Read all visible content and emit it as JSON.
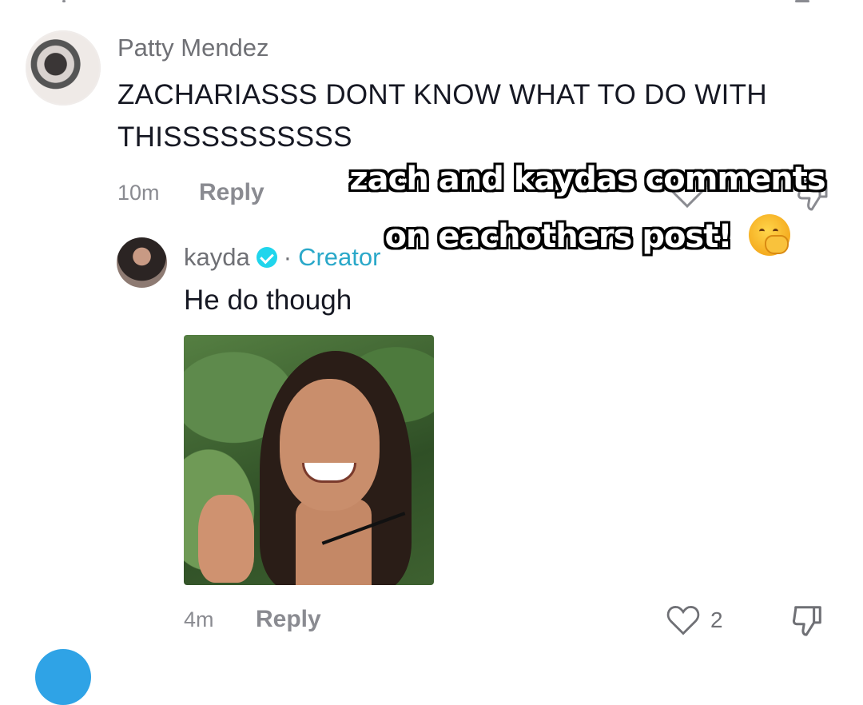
{
  "comments": [
    {
      "author": "Patty Mendez",
      "text": "ZACHARIASSS DONT KNOW WHAT TO DO WITH THISSSSSSSSSS",
      "time": "10m",
      "reply_label": "Reply",
      "avatar": "avatar-photo"
    }
  ],
  "reply": {
    "author": "kayda",
    "badge": "verified-icon",
    "separator": "·",
    "role": "Creator",
    "text": "He do though",
    "attachment": "reaction-image",
    "time": "4m",
    "reply_label": "Reply",
    "likes": "2"
  },
  "overlay": {
    "line1": "zach and kaydas comments",
    "line2": "on eachothers post!",
    "emoji": "face-with-hand-over-mouth"
  },
  "icons": {
    "like": "heart-icon",
    "dislike": "thumbs-down-icon"
  },
  "colors": {
    "creator_accent": "#2aa8c9",
    "verified_badge": "#20d5ec",
    "muted_text": "#8a8b91"
  }
}
